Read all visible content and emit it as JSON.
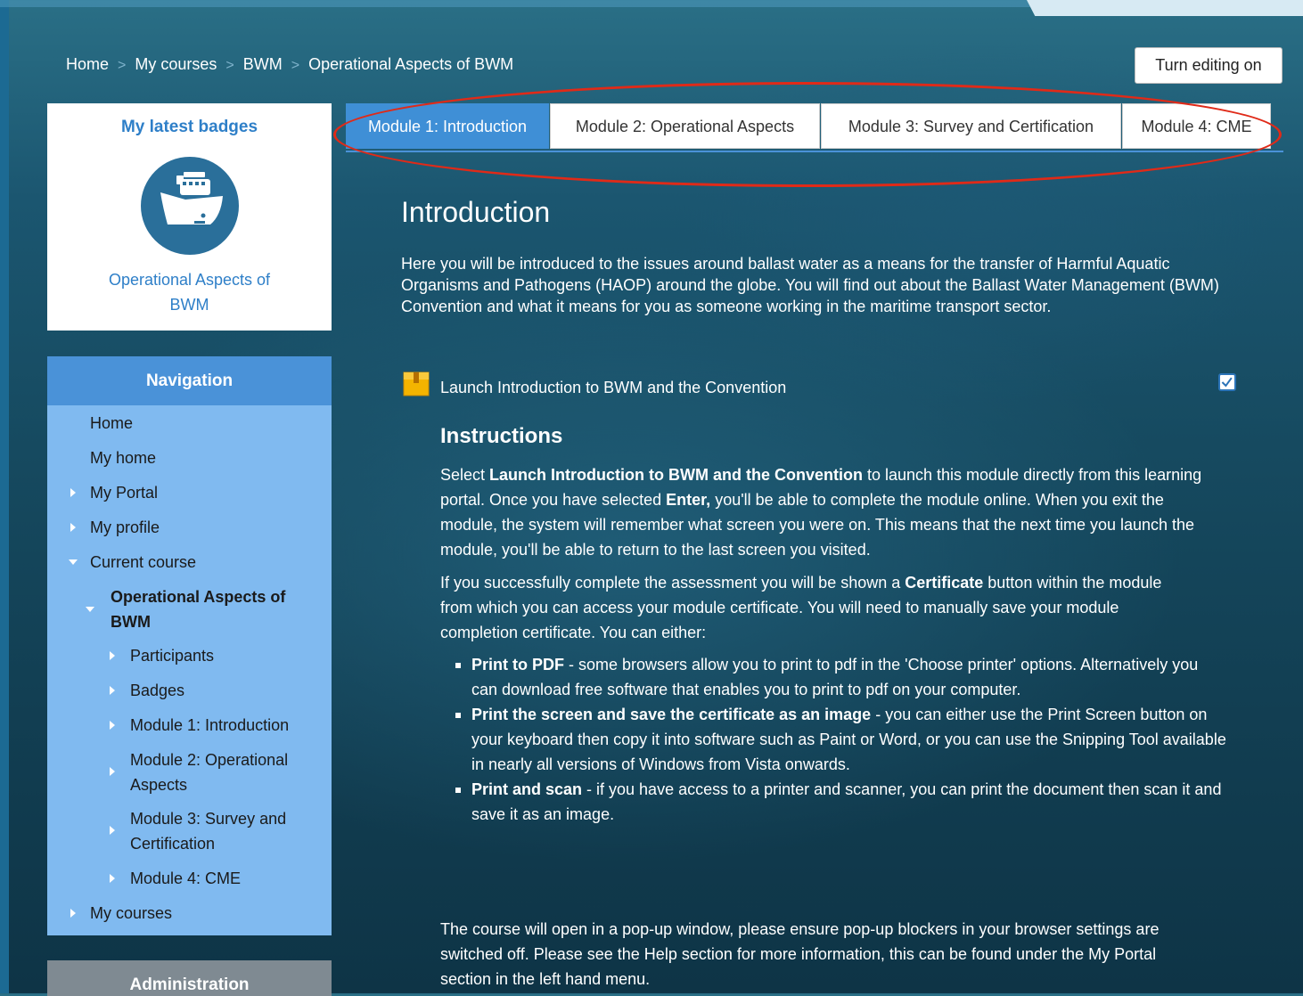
{
  "breadcrumb": {
    "items": [
      "Home",
      "My courses",
      "BWM",
      "Operational Aspects of BWM"
    ],
    "separator": ">"
  },
  "header": {
    "editing_button": "Turn editing on"
  },
  "badges_block": {
    "title": "My latest badges",
    "badge_name": "Operational Aspects of BWM",
    "badge_icon": "ship-badge-icon"
  },
  "navigation": {
    "title": "Navigation",
    "items": {
      "home": "Home",
      "my_home": "My home",
      "my_portal": "My Portal",
      "my_profile": "My profile",
      "current_course": "Current course",
      "course_name": "Operational Aspects of BWM",
      "participants": "Participants",
      "badges": "Badges",
      "module1": "Module 1: Introduction",
      "module2": "Module 2: Operational Aspects",
      "module3": "Module 3: Survey and Certification",
      "module4": "Module 4: CME",
      "my_courses": "My courses"
    }
  },
  "administration": {
    "title": "Administration"
  },
  "tabs": [
    "Module 1: Introduction",
    "Module 2: Operational Aspects",
    "Module 3: Survey and Certification",
    "Module 4: CME"
  ],
  "main": {
    "title": "Introduction",
    "summary": "Here you will be introduced to the issues around ballast water as a means for the transfer of Harmful Aquatic Organisms and Pathogens (HAOP) around the globe. You will find out about the Ballast Water Management (BWM) Convention and what it means for you as someone working in the maritime transport sector.",
    "activity_link": "Launch Introduction to BWM and the Convention",
    "activity_icon": "package-icon",
    "completion_icon": "checkbox-checked-icon",
    "instructions_heading": "Instructions",
    "p1": {
      "a": "Select ",
      "b1": "Launch Introduction to BWM and the Convention",
      "c": " to launch this module directly from this learning portal. Once you have selected ",
      "b2": "Enter,",
      "d": " you'll be able to complete the module online. When you exit the module, the system will remember what screen you were on. This means that the next time you launch the module, you'll be able to return to the last screen you visited."
    },
    "p2": {
      "a": "If you successfully complete the assessment you will be shown a ",
      "b": "Certificate",
      "c": " button within the module from which you can access your module certificate. You will need to manually save your module completion certificate. You can either:"
    },
    "bullets": [
      {
        "bold": "Print to PDF",
        "text": " - some browsers allow you to print to pdf in the 'Choose printer' options. Alternatively you can download free software that enables you to print to pdf on your computer."
      },
      {
        "bold": "Print the screen and save the certificate as an image",
        "text": " - you can either use the Print Screen button on your keyboard then copy it into software such as Paint or Word, or you can use the Snipping Tool available in nearly all versions of Windows from Vista onwards."
      },
      {
        "bold": "Print and scan",
        "text": " - if you have access to a printer and scanner, you can print the document then scan it and save it as an image."
      }
    ],
    "p3": "The course will open in a pop-up window, please ensure pop-up blockers in your browser settings are switched off. Please see the Help section for more information, this can be found under the My Portal section in the left hand menu."
  },
  "colors": {
    "accent_blue": "#3f8fd6",
    "nav_background": "#80baf0",
    "highlight_ellipse": "#e02a18",
    "admin_header": "#7f8a92"
  }
}
